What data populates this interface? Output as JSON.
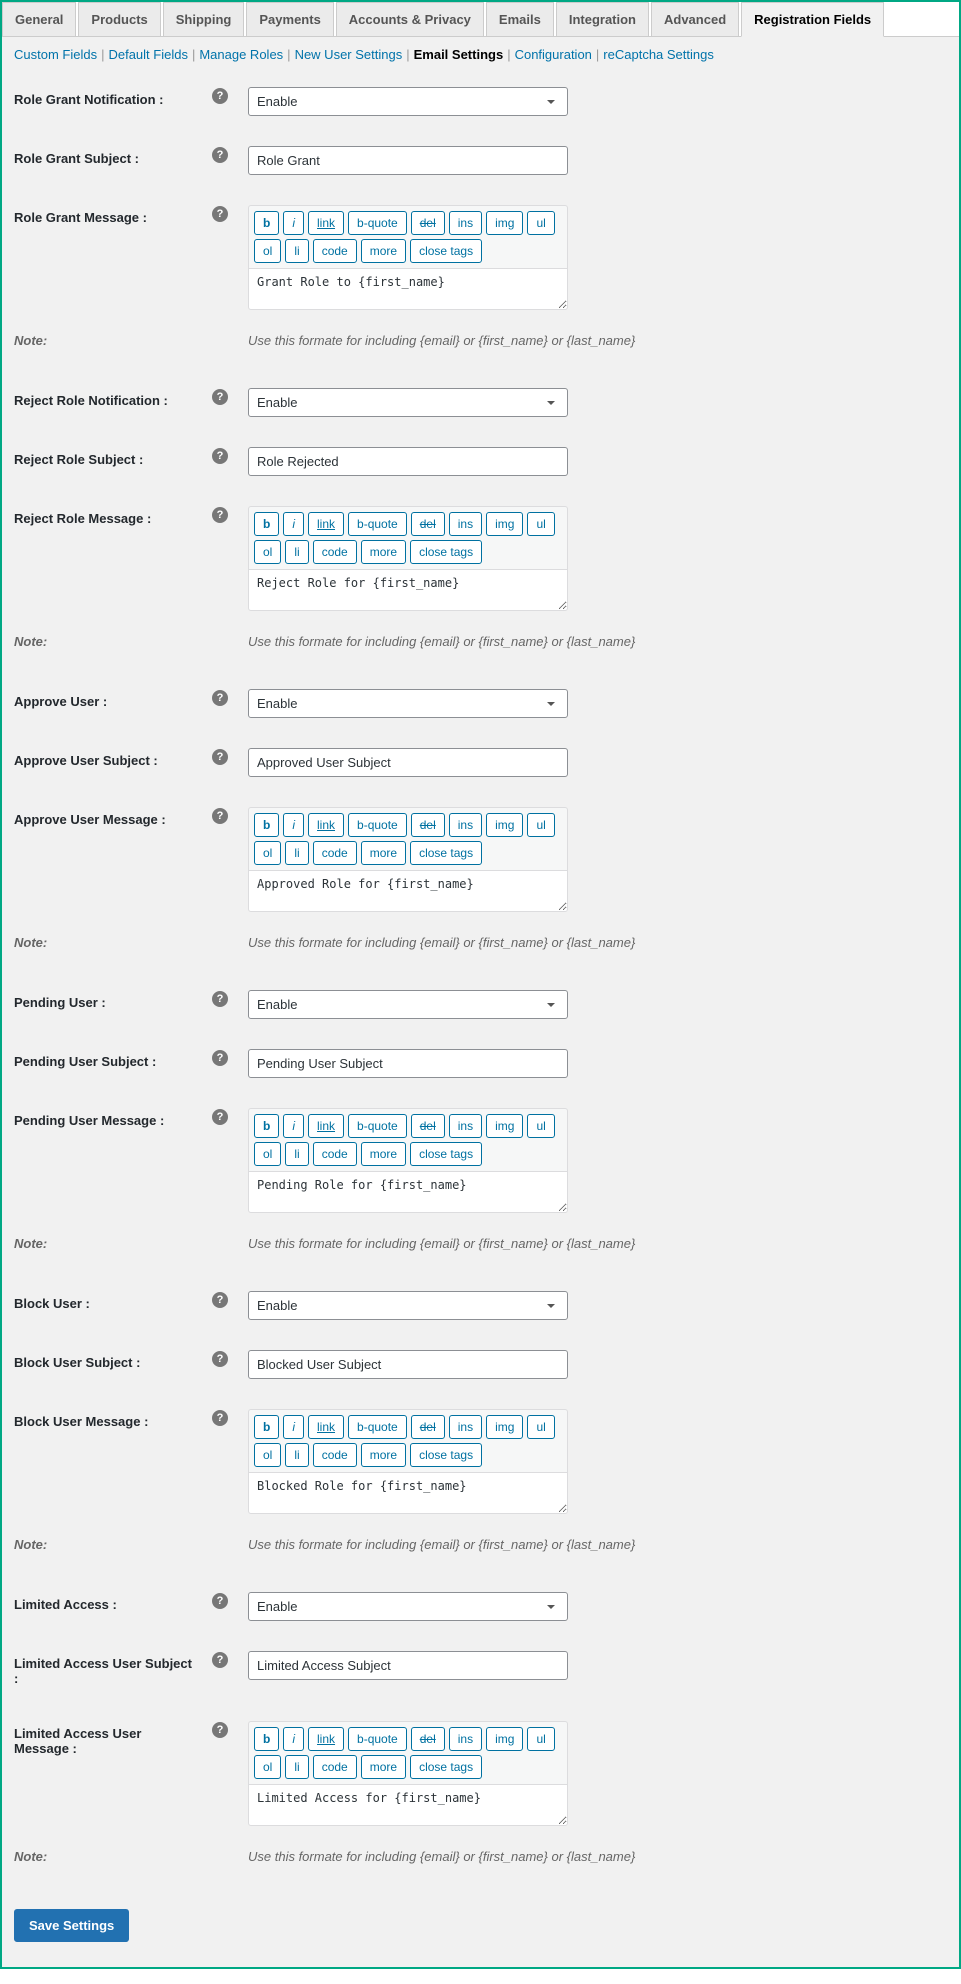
{
  "tabs": [
    "General",
    "Products",
    "Shipping",
    "Payments",
    "Accounts & Privacy",
    "Emails",
    "Integration",
    "Advanced",
    "Registration Fields"
  ],
  "active_tab": 8,
  "subnav": [
    "Custom Fields",
    "Default Fields",
    "Manage Roles",
    "New User Settings",
    "Email Settings",
    "Configuration",
    "reCaptcha Settings"
  ],
  "active_sub": 4,
  "qt": {
    "b": "b",
    "i": "i",
    "link": "link",
    "bquote": "b-quote",
    "del": "del",
    "ins": "ins",
    "img": "img",
    "ul": "ul",
    "ol": "ol",
    "li": "li",
    "code": "code",
    "more": "more",
    "close": "close tags"
  },
  "select_enable": "Enable",
  "note_label": "Note:",
  "note_text": "Use this formate for including {email} or {first_name} or {last_name}",
  "save_label": "Save Settings",
  "sections": {
    "grant": {
      "notif_label": "Role Grant Notification :",
      "subj_label": "Role Grant Subject :",
      "msg_label": "Role Grant Message :",
      "subj_val": "Role Grant",
      "msg_val": "Grant Role to {first_name}"
    },
    "reject": {
      "notif_label": "Reject Role Notification :",
      "subj_label": "Reject Role Subject :",
      "msg_label": "Reject Role Message :",
      "subj_val": "Role Rejected",
      "msg_val": "Reject Role for {first_name}"
    },
    "approve": {
      "notif_label": "Approve User :",
      "subj_label": "Approve User Subject :",
      "msg_label": "Approve User Message :",
      "subj_val": "Approved User Subject",
      "msg_val": "Approved Role for {first_name}"
    },
    "pending": {
      "notif_label": "Pending User :",
      "subj_label": "Pending User Subject :",
      "msg_label": "Pending User Message :",
      "subj_val": "Pending User Subject",
      "msg_val": "Pending Role for {first_name}"
    },
    "block": {
      "notif_label": "Block User :",
      "subj_label": "Block User Subject :",
      "msg_label": "Block User Message :",
      "subj_val": "Blocked User Subject",
      "msg_val": "Blocked Role for {first_name}"
    },
    "limited": {
      "notif_label": "Limited Access :",
      "subj_label": "Limited Access User Subject :",
      "msg_label": "Limited Access User Message :",
      "subj_val": "Limited Access Subject",
      "msg_val": "Limited Access for {first_name}"
    }
  }
}
